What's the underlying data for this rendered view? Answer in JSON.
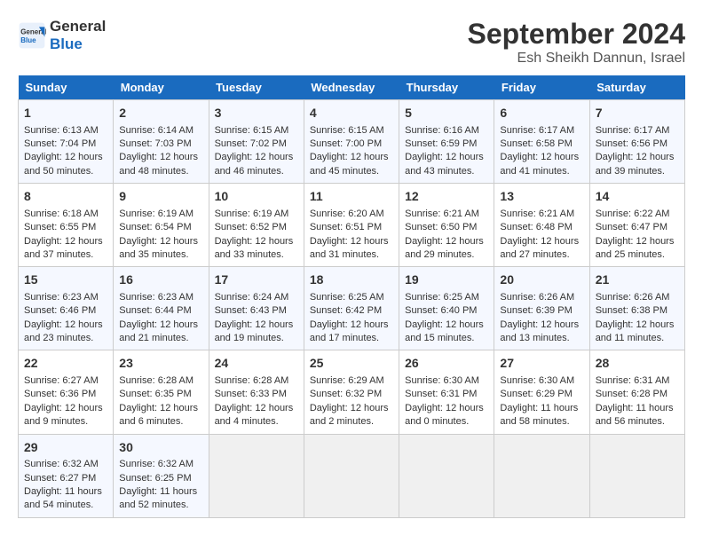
{
  "header": {
    "logo_line1": "General",
    "logo_line2": "Blue",
    "month": "September 2024",
    "location": "Esh Sheikh Dannun, Israel"
  },
  "days_of_week": [
    "Sunday",
    "Monday",
    "Tuesday",
    "Wednesday",
    "Thursday",
    "Friday",
    "Saturday"
  ],
  "weeks": [
    [
      {
        "day": "1",
        "sunrise": "6:13 AM",
        "sunset": "7:04 PM",
        "daylight": "12 hours and 50 minutes."
      },
      {
        "day": "2",
        "sunrise": "6:14 AM",
        "sunset": "7:03 PM",
        "daylight": "12 hours and 48 minutes."
      },
      {
        "day": "3",
        "sunrise": "6:15 AM",
        "sunset": "7:02 PM",
        "daylight": "12 hours and 46 minutes."
      },
      {
        "day": "4",
        "sunrise": "6:15 AM",
        "sunset": "7:00 PM",
        "daylight": "12 hours and 45 minutes."
      },
      {
        "day": "5",
        "sunrise": "6:16 AM",
        "sunset": "6:59 PM",
        "daylight": "12 hours and 43 minutes."
      },
      {
        "day": "6",
        "sunrise": "6:17 AM",
        "sunset": "6:58 PM",
        "daylight": "12 hours and 41 minutes."
      },
      {
        "day": "7",
        "sunrise": "6:17 AM",
        "sunset": "6:56 PM",
        "daylight": "12 hours and 39 minutes."
      }
    ],
    [
      {
        "day": "8",
        "sunrise": "6:18 AM",
        "sunset": "6:55 PM",
        "daylight": "12 hours and 37 minutes."
      },
      {
        "day": "9",
        "sunrise": "6:19 AM",
        "sunset": "6:54 PM",
        "daylight": "12 hours and 35 minutes."
      },
      {
        "day": "10",
        "sunrise": "6:19 AM",
        "sunset": "6:52 PM",
        "daylight": "12 hours and 33 minutes."
      },
      {
        "day": "11",
        "sunrise": "6:20 AM",
        "sunset": "6:51 PM",
        "daylight": "12 hours and 31 minutes."
      },
      {
        "day": "12",
        "sunrise": "6:21 AM",
        "sunset": "6:50 PM",
        "daylight": "12 hours and 29 minutes."
      },
      {
        "day": "13",
        "sunrise": "6:21 AM",
        "sunset": "6:48 PM",
        "daylight": "12 hours and 27 minutes."
      },
      {
        "day": "14",
        "sunrise": "6:22 AM",
        "sunset": "6:47 PM",
        "daylight": "12 hours and 25 minutes."
      }
    ],
    [
      {
        "day": "15",
        "sunrise": "6:23 AM",
        "sunset": "6:46 PM",
        "daylight": "12 hours and 23 minutes."
      },
      {
        "day": "16",
        "sunrise": "6:23 AM",
        "sunset": "6:44 PM",
        "daylight": "12 hours and 21 minutes."
      },
      {
        "day": "17",
        "sunrise": "6:24 AM",
        "sunset": "6:43 PM",
        "daylight": "12 hours and 19 minutes."
      },
      {
        "day": "18",
        "sunrise": "6:25 AM",
        "sunset": "6:42 PM",
        "daylight": "12 hours and 17 minutes."
      },
      {
        "day": "19",
        "sunrise": "6:25 AM",
        "sunset": "6:40 PM",
        "daylight": "12 hours and 15 minutes."
      },
      {
        "day": "20",
        "sunrise": "6:26 AM",
        "sunset": "6:39 PM",
        "daylight": "12 hours and 13 minutes."
      },
      {
        "day": "21",
        "sunrise": "6:26 AM",
        "sunset": "6:38 PM",
        "daylight": "12 hours and 11 minutes."
      }
    ],
    [
      {
        "day": "22",
        "sunrise": "6:27 AM",
        "sunset": "6:36 PM",
        "daylight": "12 hours and 9 minutes."
      },
      {
        "day": "23",
        "sunrise": "6:28 AM",
        "sunset": "6:35 PM",
        "daylight": "12 hours and 6 minutes."
      },
      {
        "day": "24",
        "sunrise": "6:28 AM",
        "sunset": "6:33 PM",
        "daylight": "12 hours and 4 minutes."
      },
      {
        "day": "25",
        "sunrise": "6:29 AM",
        "sunset": "6:32 PM",
        "daylight": "12 hours and 2 minutes."
      },
      {
        "day": "26",
        "sunrise": "6:30 AM",
        "sunset": "6:31 PM",
        "daylight": "12 hours and 0 minutes."
      },
      {
        "day": "27",
        "sunrise": "6:30 AM",
        "sunset": "6:29 PM",
        "daylight": "11 hours and 58 minutes."
      },
      {
        "day": "28",
        "sunrise": "6:31 AM",
        "sunset": "6:28 PM",
        "daylight": "11 hours and 56 minutes."
      }
    ],
    [
      {
        "day": "29",
        "sunrise": "6:32 AM",
        "sunset": "6:27 PM",
        "daylight": "11 hours and 54 minutes."
      },
      {
        "day": "30",
        "sunrise": "6:32 AM",
        "sunset": "6:25 PM",
        "daylight": "11 hours and 52 minutes."
      },
      null,
      null,
      null,
      null,
      null
    ]
  ]
}
